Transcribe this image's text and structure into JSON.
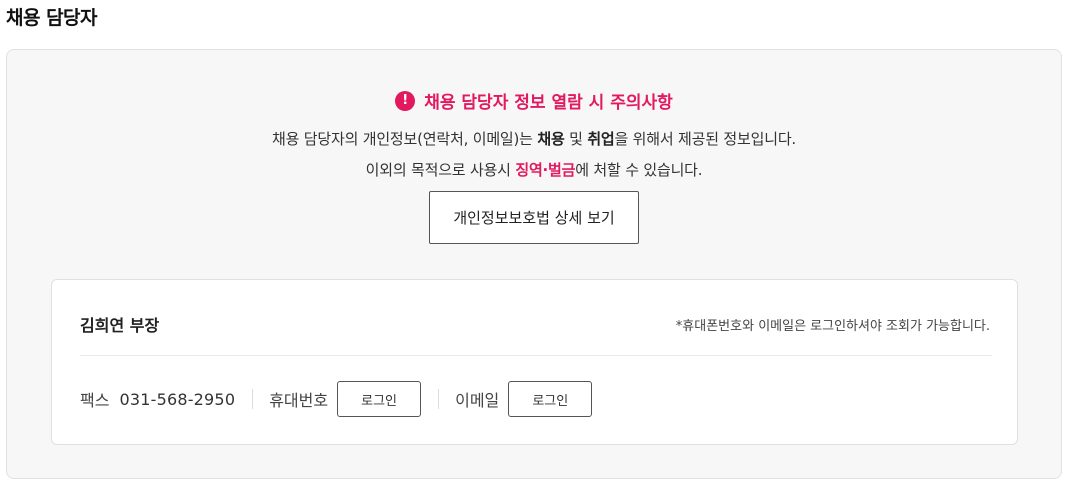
{
  "section": {
    "title": "채용 담당자"
  },
  "notice": {
    "icon": "exclamation-circle-icon",
    "icon_glyph": "!",
    "title": "채용 담당자 정보 열람 시 주의사항",
    "line1": {
      "part1": "채용 담당자의 개인정보(연락처, 이메일)는 ",
      "bold1": "채용",
      "part2": " 및 ",
      "bold2": "취업",
      "part3": "을 위해서 제공된 정보입니다."
    },
    "line2": {
      "part1": "이외의 목적으로 사용시 ",
      "highlight": "징역·벌금",
      "part2": "에 처할 수 있습니다."
    },
    "button_label": "개인정보보호법 상세 보기",
    "accent_color": "#e2195f"
  },
  "contact": {
    "name": "김희연 부장",
    "login_note": "*휴대폰번호와 이메일은 로그인하셔야 조회가 가능합니다.",
    "fax_label": "팩스",
    "fax_value": "031-568-2950",
    "mobile_label": "휴대번호",
    "mobile_button": "로그인",
    "email_label": "이메일",
    "email_button": "로그인"
  }
}
